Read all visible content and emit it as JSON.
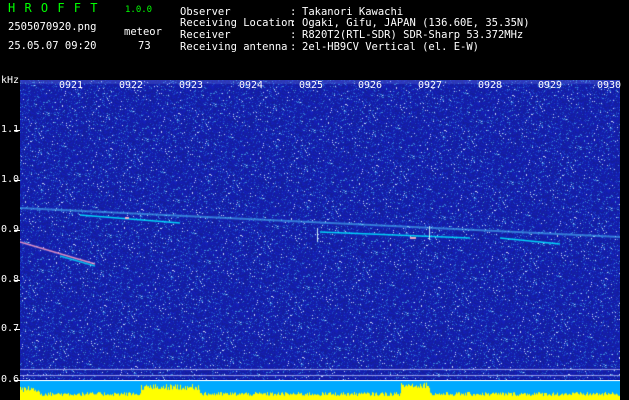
{
  "app": {
    "name": "H R O F F T",
    "version": "1.0.0"
  },
  "file": {
    "name": "2505070920.png",
    "timestamp": "25.05.07 09:20"
  },
  "counter": {
    "label": "meteor",
    "value": "73"
  },
  "info": [
    {
      "key": "Observer",
      "value": "Takanori Kawachi"
    },
    {
      "key": "Receiving Location",
      "value": "Ogaki, Gifu, JAPAN (136.60E, 35.35N)"
    },
    {
      "key": "Receiver",
      "value": "R820T2(RTL-SDR) SDR-Sharp 53.372MHz"
    },
    {
      "key": "Receiving antenna",
      "value": "2el-HB9CV Vertical (el. E-W)"
    }
  ],
  "axis": {
    "unit": "kHz",
    "y_ticks": [
      "1.1",
      "1.0",
      "0.9",
      "0.8",
      "0.7",
      "0.6"
    ],
    "x_ticks": [
      "0921",
      "0922",
      "0923",
      "0924",
      "0925",
      "0926",
      "0927",
      "0928",
      "0929",
      "0930"
    ]
  },
  "colors": {
    "green_text": "#00ff00",
    "background": "#1a2aa0",
    "trace": "#00e0ff",
    "level": "#ffff00"
  }
}
